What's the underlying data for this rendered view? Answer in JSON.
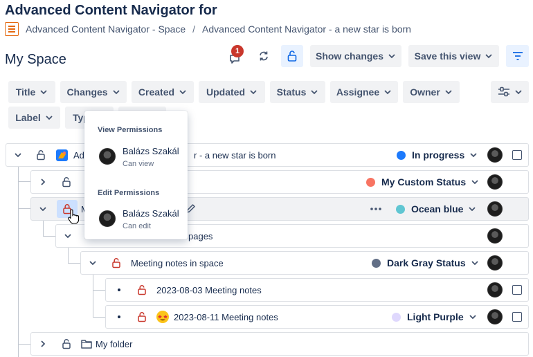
{
  "page": {
    "title": "Advanced Content Navigator for",
    "breadcrumbs": [
      "Advanced Content Navigator - Space",
      "Advanced Content Navigator - a new star is born"
    ],
    "space_title": "My Space"
  },
  "toolbar": {
    "notification_count": "1",
    "show_changes_label": "Show changes",
    "save_view_label": "Save this view"
  },
  "filters": [
    "Title",
    "Changes",
    "Created",
    "Updated",
    "Status",
    "Assignee",
    "Owner",
    "Label",
    "Typ",
    ""
  ],
  "popup": {
    "view_header": "View Permissions",
    "view_user": "Balázs Szakál",
    "view_role": "Can view",
    "edit_header": "Edit Permissions",
    "edit_user": "Balázs Szakál",
    "edit_role": "Can edit"
  },
  "rows": [
    {
      "title_visible": "Ad",
      "title_tail": "r - a new star is born",
      "status": "In progress",
      "status_color": "#1d7afc"
    },
    {
      "title_visible": "",
      "status": "My Custom Status",
      "status_color": "#f87462"
    },
    {
      "title_visible": "M",
      "status": "Ocean blue",
      "status_color": "#60c6d2"
    },
    {
      "title_visible": "pages",
      "status": ""
    },
    {
      "title_visible": "Meeting notes in space",
      "status": "Dark Gray Status",
      "status_color": "#626f86"
    },
    {
      "title_visible": "2023-08-03 Meeting notes",
      "status": ""
    },
    {
      "title_visible": "2023-08-11 Meeting notes",
      "status": "Light Purple",
      "status_color": "#dfd8fd"
    },
    {
      "title_visible": "My folder",
      "status": ""
    }
  ],
  "colors": {
    "lock_unlocked": "#44546f",
    "lock_restricted": "#c9372c",
    "accent_blue": "#0c66e4",
    "active_button_bg": "#e9f2ff"
  }
}
